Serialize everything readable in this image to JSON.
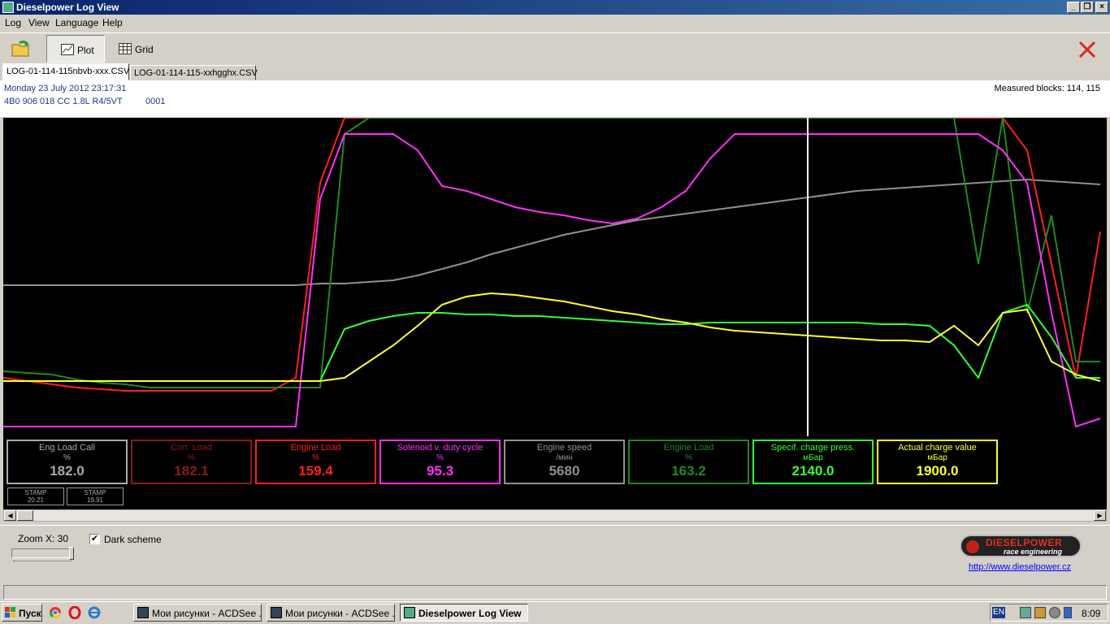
{
  "window": {
    "title": "Dieselpower Log View"
  },
  "menu": [
    "Log",
    "View",
    "Language",
    "Help"
  ],
  "toolbar": {
    "plot_label": "Plot",
    "grid_label": "Grid"
  },
  "tabs": [
    "LOG-01-114-115nbvb-xxx.CSV",
    "LOG-01-114-115-xxhgghx.CSV"
  ],
  "info": {
    "datetime": "Monday 23 July 2012 23:17:31",
    "ecu": "4B0 906 018 CC  1.8L R4/5VT",
    "code": "0001",
    "measured_blocks": "Measured blocks: 114, 115"
  },
  "gauges": [
    {
      "name": "Eng Load Call",
      "unit": "%",
      "value": "182.0",
      "color": "#aaaaaa"
    },
    {
      "name": "Corr. Load",
      "unit": "%",
      "value": "182.1",
      "color": "#8b1a1a"
    },
    {
      "name": "Engine Load",
      "unit": "%",
      "value": "159.4",
      "color": "#ff2020"
    },
    {
      "name": "Solenoid v. duty cycle",
      "unit": "%",
      "value": "95.3",
      "color": "#ff30ff"
    },
    {
      "name": "Engine speed",
      "unit": "/мин",
      "value": "5680",
      "color": "#909090"
    },
    {
      "name": "Engine Load",
      "unit": "%",
      "value": "163.2",
      "color": "#1f8a1f"
    },
    {
      "name": "Specif. charge press.",
      "unit": "мБар",
      "value": "2140.0",
      "color": "#33ff33"
    },
    {
      "name": "Actual charge value",
      "unit": "мБар",
      "value": "1900.0",
      "color": "#ffff33"
    }
  ],
  "stamps": [
    {
      "label": "STAMP",
      "value": "20.21"
    },
    {
      "label": "STAMP",
      "value": "19.91"
    }
  ],
  "bottom": {
    "zoom_label": "Zoom X: 30",
    "dark_scheme_label": "Dark scheme",
    "dark_scheme_checked": true,
    "logo_title": "DIESELPOWER",
    "logo_subtitle": "race engineering",
    "link": "http://www.dieselpower.cz"
  },
  "taskbar": {
    "start_label": "Пуск",
    "tasks": [
      "Мои рисунки - ACDSee ...",
      "Мои рисунки - ACDSee ...",
      "Dieselpower Log View"
    ],
    "lang": "EN",
    "clock": "8:09"
  },
  "chart_data": {
    "type": "line",
    "x": [
      0,
      30,
      60,
      90,
      120,
      150,
      180,
      210,
      240,
      270,
      300,
      330,
      360,
      390,
      420,
      450,
      480,
      510,
      540,
      570,
      600,
      630,
      660,
      690,
      720,
      750,
      780,
      810,
      840,
      870,
      900,
      930,
      960,
      990,
      1020,
      1050,
      1080,
      1110,
      1140,
      1170,
      1200,
      1230,
      1260,
      1290,
      1320,
      1350
    ],
    "cursor_x": 990,
    "series": [
      {
        "color": "#909090",
        "y": [
          103,
          103,
          103,
          103,
          103,
          103,
          103,
          103,
          103,
          103,
          103,
          103,
          103,
          102,
          102,
          101,
          100,
          97,
          93,
          89,
          84,
          80,
          76,
          72,
          69,
          66,
          63,
          61,
          59,
          57,
          55,
          53,
          51,
          49,
          47,
          45,
          44,
          43,
          42,
          41,
          40,
          39,
          38,
          39,
          40,
          41
        ]
      },
      {
        "color": "#ff2020",
        "y": [
          160,
          162,
          164,
          166,
          167,
          168,
          168,
          168,
          168,
          168,
          168,
          168,
          160,
          40,
          0,
          0,
          0,
          0,
          0,
          0,
          0,
          0,
          0,
          0,
          0,
          0,
          0,
          0,
          0,
          0,
          0,
          0,
          0,
          0,
          0,
          0,
          0,
          0,
          0,
          0,
          0,
          0,
          20,
          90,
          160,
          70
        ]
      },
      {
        "color": "#1f8a1f",
        "y": [
          156,
          157,
          158,
          161,
          163,
          164,
          166,
          166,
          166,
          166,
          166,
          166,
          166,
          166,
          10,
          0,
          0,
          0,
          0,
          0,
          0,
          0,
          0,
          0,
          0,
          0,
          0,
          0,
          0,
          0,
          0,
          0,
          0,
          0,
          0,
          0,
          0,
          0,
          0,
          0,
          90,
          0,
          120,
          60,
          150,
          150
        ]
      },
      {
        "color": "#ff30ff",
        "y": [
          190,
          190,
          190,
          190,
          190,
          190,
          190,
          190,
          190,
          190,
          190,
          190,
          190,
          50,
          10,
          10,
          10,
          20,
          42,
          45,
          50,
          55,
          58,
          60,
          63,
          65,
          62,
          55,
          45,
          25,
          10,
          10,
          10,
          10,
          10,
          10,
          10,
          10,
          10,
          10,
          10,
          20,
          40,
          120,
          190,
          185
        ]
      },
      {
        "color": "#33ff33",
        "y": [
          162,
          162,
          162,
          162,
          162,
          162,
          162,
          162,
          162,
          162,
          162,
          162,
          162,
          162,
          130,
          125,
          122,
          120,
          120,
          121,
          121,
          122,
          122,
          123,
          124,
          125,
          126,
          127,
          127,
          126,
          126,
          126,
          126,
          126,
          126,
          126,
          127,
          127,
          128,
          140,
          160,
          120,
          115,
          135,
          160,
          160
        ]
      },
      {
        "color": "#ffff33",
        "y": [
          162,
          162,
          162,
          162,
          162,
          162,
          162,
          162,
          162,
          162,
          162,
          162,
          162,
          162,
          160,
          150,
          140,
          128,
          115,
          110,
          108,
          109,
          111,
          113,
          116,
          119,
          121,
          124,
          126,
          129,
          131,
          132,
          133,
          134,
          135,
          136,
          137,
          137,
          138,
          128,
          140,
          120,
          118,
          150,
          158,
          162
        ]
      }
    ]
  }
}
